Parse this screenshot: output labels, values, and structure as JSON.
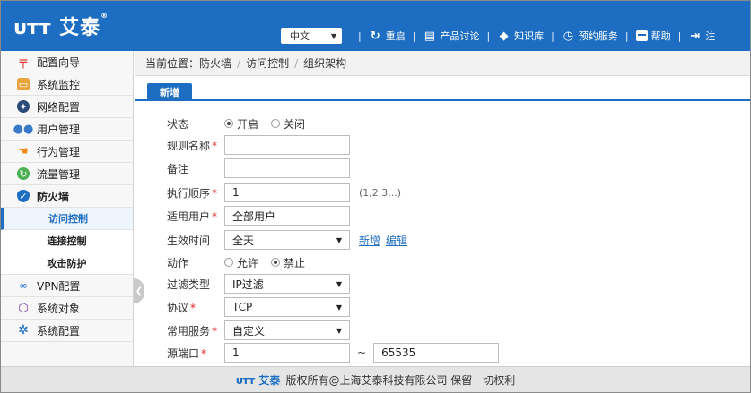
{
  "header": {
    "logo": "ᴜᴛᴛ 艾泰",
    "logo_reg": "®",
    "language": "中文",
    "toolbar": [
      {
        "label": "重启",
        "icon": "restart-icon"
      },
      {
        "label": "产品讨论",
        "icon": "chat-icon"
      },
      {
        "label": "知识库",
        "icon": "knowledge-icon"
      },
      {
        "label": "预约服务",
        "icon": "service-icon"
      },
      {
        "label": "帮助",
        "icon": "help-icon"
      },
      {
        "label": "注",
        "icon": "logout-icon"
      }
    ]
  },
  "sidebar": {
    "items": [
      {
        "label": "配置向导",
        "icon": "wizard-icon",
        "color": "#e23b2e"
      },
      {
        "label": "系统监控",
        "icon": "monitor-icon",
        "color": "#e8a33a"
      },
      {
        "label": "网络配置",
        "icon": "network-icon",
        "color": "#2b4a7a"
      },
      {
        "label": "用户管理",
        "icon": "users-icon",
        "color": "#3a78c8"
      },
      {
        "label": "行为管理",
        "icon": "behavior-icon",
        "color": "#f08a1c"
      },
      {
        "label": "流量管理",
        "icon": "traffic-icon",
        "color": "#4caf50"
      },
      {
        "label": "防火墙",
        "icon": "firewall-icon",
        "color": "#1d6ec2"
      }
    ],
    "sub_items": [
      "访问控制",
      "连接控制",
      "攻击防护"
    ],
    "items_after": [
      {
        "label": "VPN配置",
        "icon": "vpn-icon",
        "color": "#1d6ec2"
      },
      {
        "label": "系统对象",
        "icon": "object-icon",
        "color": "#7a3ea8"
      },
      {
        "label": "系统配置",
        "icon": "settings-icon",
        "color": "#1d6ec2"
      }
    ]
  },
  "breadcrumb": {
    "prefix": "当前位置：",
    "items": [
      "防火墙",
      "访问控制",
      "组织架构"
    ]
  },
  "tabs": {
    "active": "新增"
  },
  "form": {
    "status": {
      "label": "状态",
      "options": [
        "开启",
        "关闭"
      ],
      "selected": "开启"
    },
    "rule_name": {
      "label": "规则名称",
      "value": ""
    },
    "remark": {
      "label": "备注",
      "value": ""
    },
    "order": {
      "label": "执行顺序",
      "value": "1",
      "hint": "(1,2,3...)"
    },
    "users": {
      "label": "适用用户",
      "value": "全部用户"
    },
    "time": {
      "label": "生效时间",
      "value": "全天",
      "link_new": "新增",
      "link_edit": "编辑"
    },
    "action": {
      "label": "动作",
      "options": [
        "允许",
        "禁止"
      ],
      "selected": "禁止"
    },
    "filter_type": {
      "label": "过滤类型",
      "value": "IP过滤"
    },
    "protocol": {
      "label": "协议",
      "value": "TCP"
    },
    "service": {
      "label": "常用服务",
      "value": "自定义"
    },
    "src_port": {
      "label": "源端口",
      "from": "1",
      "to": "65535",
      "separator": "~"
    }
  },
  "footer": {
    "logo": "ᴜᴛᴛ 艾泰",
    "text": "版权所有@上海艾泰科技有限公司 保留一切权利"
  }
}
